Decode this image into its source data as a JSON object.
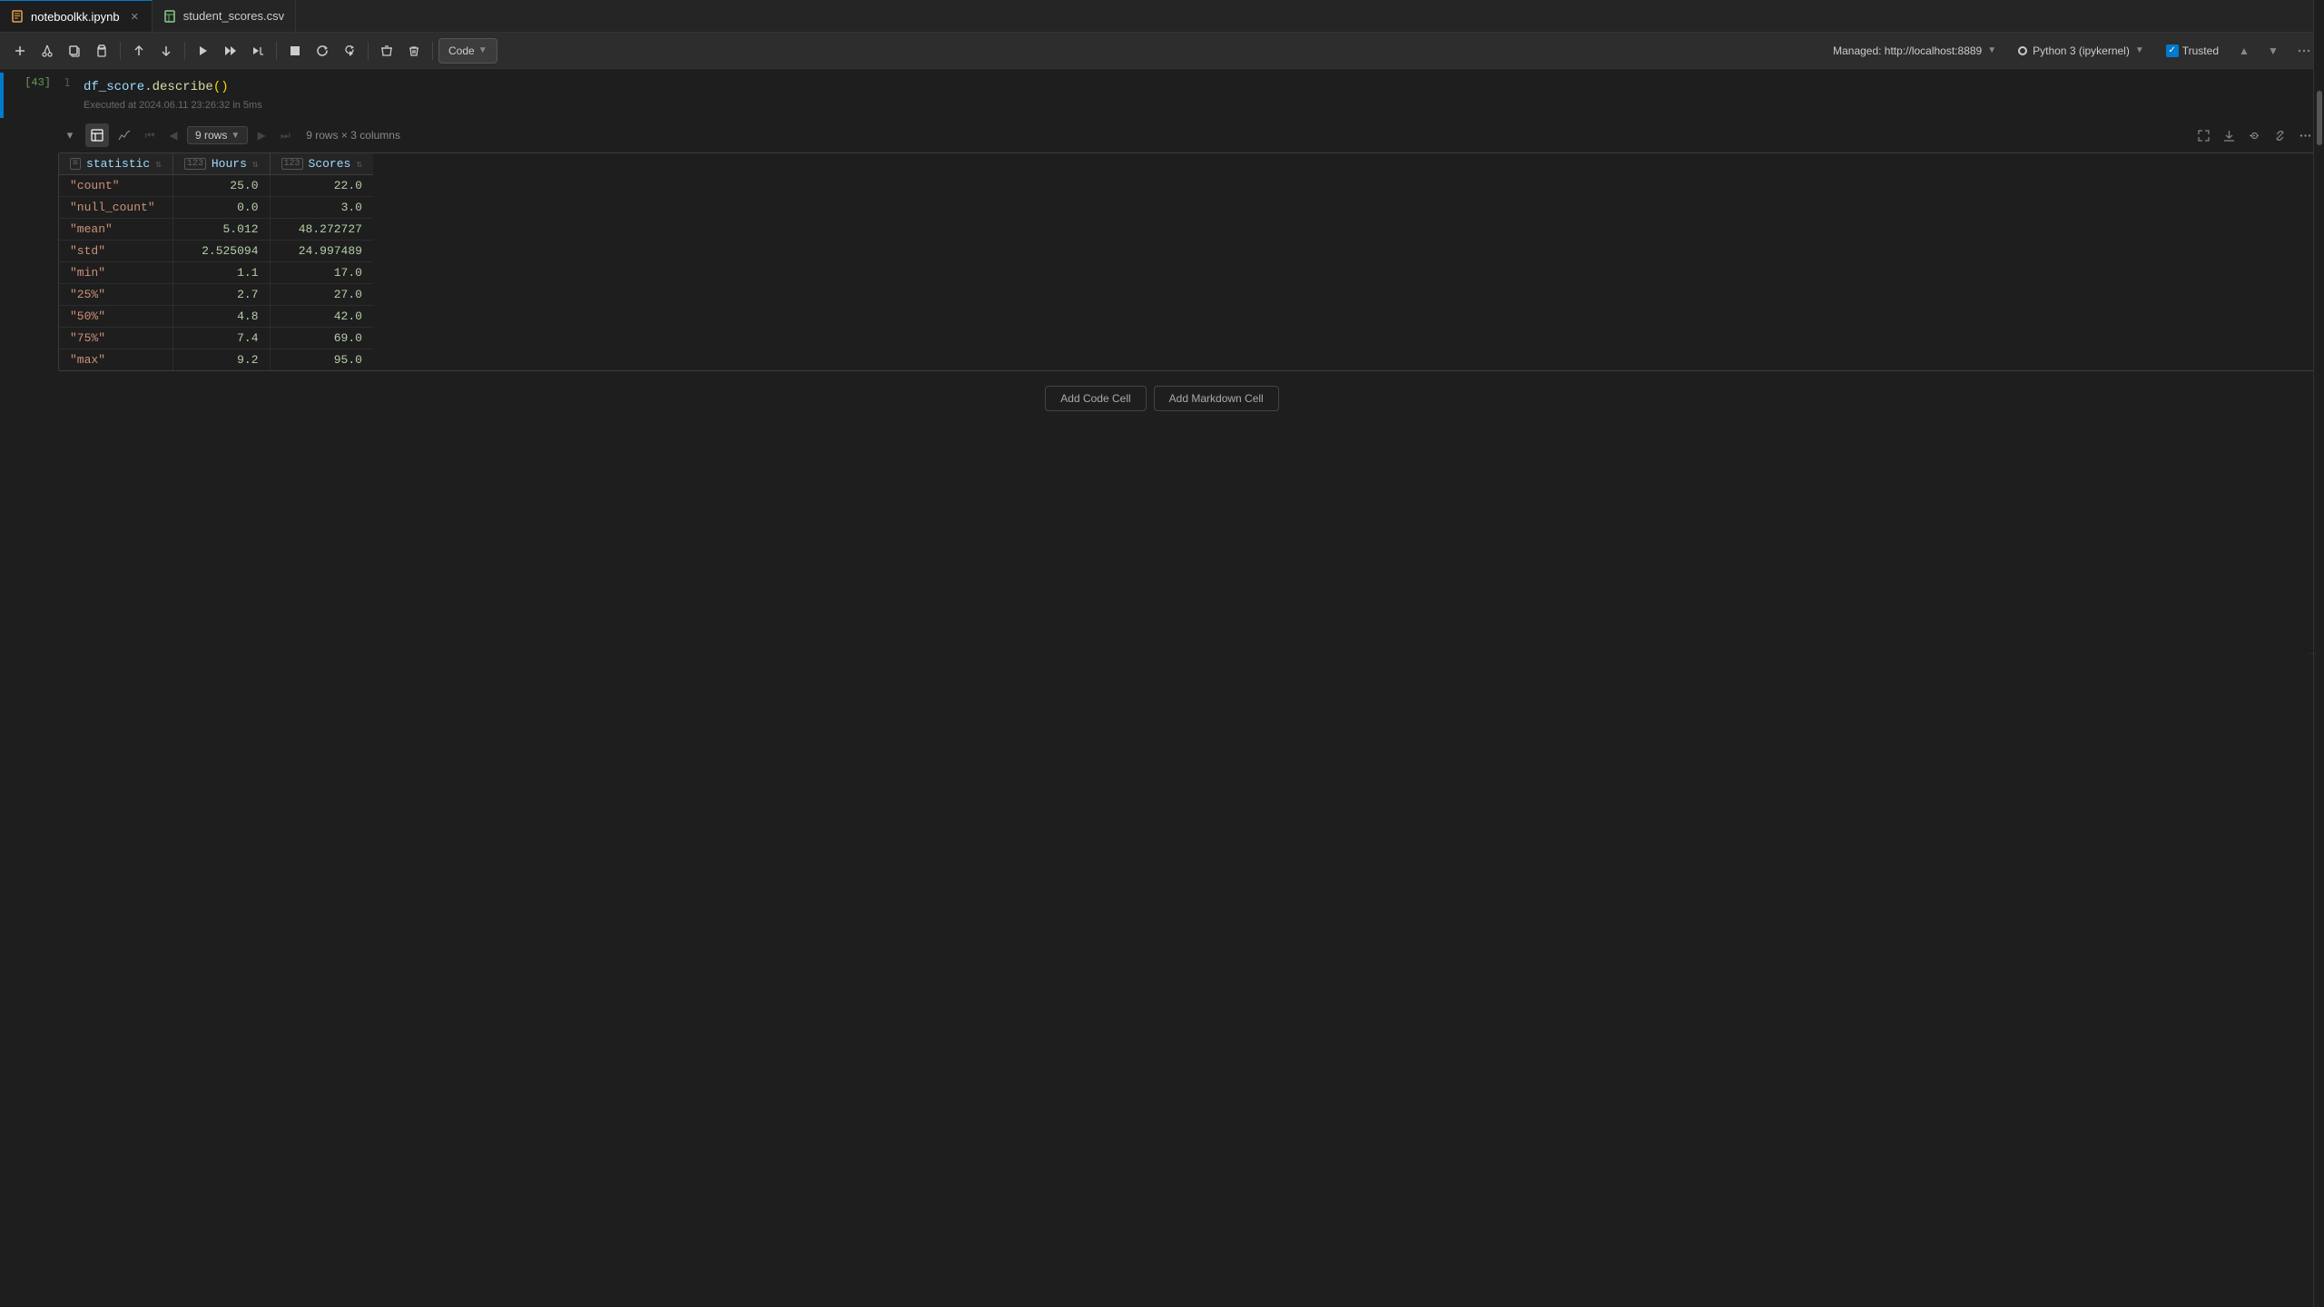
{
  "tabs": [
    {
      "id": "notebook",
      "label": "noteboolkk.ipynb",
      "active": true,
      "icon": "notebook-icon"
    },
    {
      "id": "csv",
      "label": "student_scores.csv",
      "active": false,
      "icon": "csv-icon"
    }
  ],
  "toolbar": {
    "buttons": [
      {
        "name": "add-cell-button",
        "icon": "+",
        "label": "Add Cell"
      },
      {
        "name": "cut-button",
        "icon": "✂",
        "label": "Cut"
      },
      {
        "name": "copy-button",
        "icon": "⎘",
        "label": "Copy"
      },
      {
        "name": "paste-button",
        "icon": "⎗",
        "label": "Paste"
      },
      {
        "name": "move-up-button",
        "icon": "↑",
        "label": "Move Up"
      },
      {
        "name": "move-down-button",
        "icon": "↓",
        "label": "Move Down"
      },
      {
        "name": "run-button",
        "icon": "▶",
        "label": "Run Cell"
      },
      {
        "name": "run-all-button",
        "icon": "⏩",
        "label": "Run All"
      },
      {
        "name": "run-all2-button",
        "icon": "▶▶",
        "label": "Run All Below"
      },
      {
        "name": "stop-button",
        "icon": "■",
        "label": "Stop"
      },
      {
        "name": "restart-button",
        "icon": "↺",
        "label": "Restart"
      },
      {
        "name": "restart-run-button",
        "icon": "⏭",
        "label": "Restart and Run"
      },
      {
        "name": "clear-button",
        "icon": "✕",
        "label": "Clear"
      },
      {
        "name": "delete-button",
        "icon": "🗑",
        "label": "Delete"
      }
    ],
    "code_dropdown": "Code",
    "kernel_url": "Managed: http://localhost:8889",
    "kernel_name": "Python 3 (ipykernel)",
    "trusted_label": "Trusted"
  },
  "cell": {
    "number": "[43]",
    "line_number": "1",
    "code": "df_score.describe()",
    "executed": "Executed at 2024.06.11 23:26:32 in 5ms"
  },
  "output": {
    "rows_label": "9 rows",
    "rows_info": "9 rows × 3 columns",
    "columns": [
      {
        "name": "statistic",
        "type": "≡"
      },
      {
        "name": "Hours",
        "type": "123"
      },
      {
        "name": "Scores",
        "type": "123"
      }
    ],
    "rows": [
      {
        "statistic": "\"count\"",
        "hours": "25.0",
        "scores": "22.0"
      },
      {
        "statistic": "\"null_count\"",
        "hours": "0.0",
        "scores": "3.0"
      },
      {
        "statistic": "\"mean\"",
        "hours": "5.012",
        "scores": "48.272727"
      },
      {
        "statistic": "\"std\"",
        "hours": "2.525094",
        "scores": "24.997489"
      },
      {
        "statistic": "\"min\"",
        "hours": "1.1",
        "scores": "17.0"
      },
      {
        "statistic": "\"25%\"",
        "hours": "2.7",
        "scores": "27.0"
      },
      {
        "statistic": "\"50%\"",
        "hours": "4.8",
        "scores": "42.0"
      },
      {
        "statistic": "\"75%\"",
        "hours": "7.4",
        "scores": "69.0"
      },
      {
        "statistic": "\"max\"",
        "hours": "9.2",
        "scores": "95.0"
      }
    ]
  },
  "bottom_buttons": {
    "add_code": "Add Code Cell",
    "add_markdown": "Add Markdown Cell"
  }
}
